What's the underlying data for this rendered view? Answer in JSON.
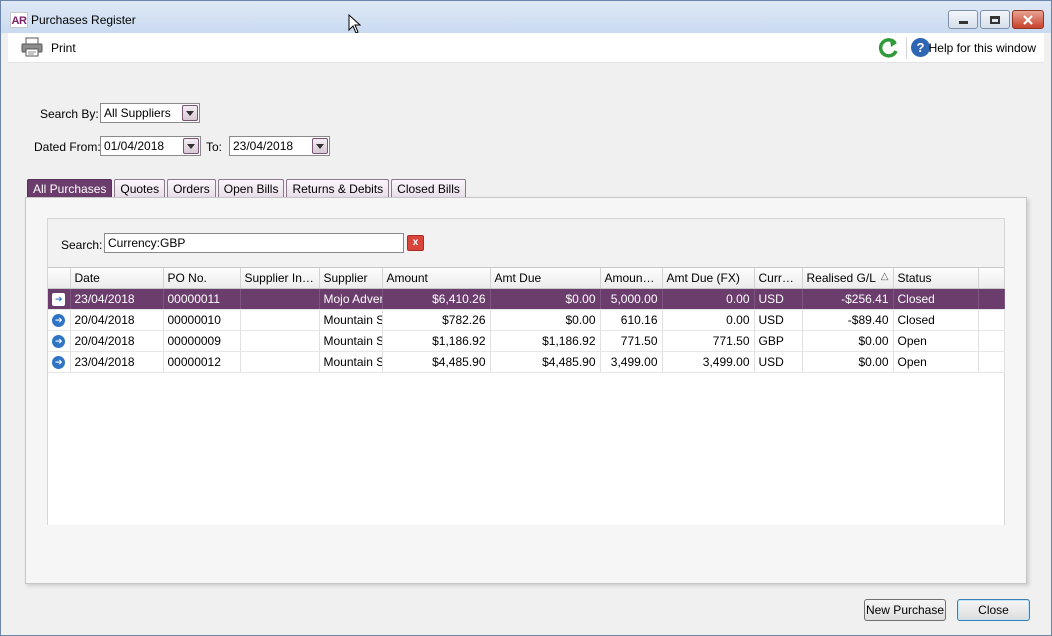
{
  "window": {
    "app_logo": "AR",
    "title": "Purchases Register"
  },
  "toolbar": {
    "print_label": "Print",
    "refresh_icon": "refresh-icon",
    "help_label": "Help for this window",
    "help_glyph": "?"
  },
  "filters": {
    "search_by_label": "Search By:",
    "search_by_value": "All Suppliers",
    "dated_from_label": "Dated From:",
    "dated_from_value": "01/04/2018",
    "to_label": "To:",
    "to_value": "23/04/2018"
  },
  "tabs": [
    {
      "label": "All Purchases",
      "active": true
    },
    {
      "label": "Quotes",
      "active": false
    },
    {
      "label": "Orders",
      "active": false
    },
    {
      "label": "Open Bills",
      "active": false
    },
    {
      "label": "Returns & Debits",
      "active": false
    },
    {
      "label": "Closed Bills",
      "active": false
    }
  ],
  "search": {
    "label": "Search:",
    "value": "Currency:GBP",
    "clear_glyph": "x"
  },
  "grid": {
    "columns": [
      "",
      "Date",
      "PO No.",
      "Supplier Inv...",
      "Supplier",
      "Amount",
      "Amt Due",
      "Amount ...",
      "Amt Due (FX)",
      "Curre...",
      "Realised G/L",
      "Status",
      ""
    ],
    "sort_indicator": "△",
    "rows": [
      {
        "date": "23/04/2018",
        "po": "00000011",
        "supplier_inv": "",
        "supplier": "Mojo Adver",
        "amount": "$6,410.26",
        "amt_due": "$0.00",
        "amount_fx": "5,000.00",
        "amt_due_fx": "0.00",
        "currency": "USD",
        "realised": "-$256.41",
        "status": "Closed",
        "selected": true
      },
      {
        "date": "20/04/2018",
        "po": "00000010",
        "supplier_inv": "",
        "supplier": "Mountain Sp",
        "amount": "$782.26",
        "amt_due": "$0.00",
        "amount_fx": "610.16",
        "amt_due_fx": "0.00",
        "currency": "USD",
        "realised": "-$89.40",
        "status": "Closed",
        "selected": false
      },
      {
        "date": "20/04/2018",
        "po": "00000009",
        "supplier_inv": "",
        "supplier": "Mountain Sp",
        "amount": "$1,186.92",
        "amt_due": "$1,186.92",
        "amount_fx": "771.50",
        "amt_due_fx": "771.50",
        "currency": "GBP",
        "realised": "$0.00",
        "status": "Open",
        "selected": false
      },
      {
        "date": "23/04/2018",
        "po": "00000012",
        "supplier_inv": "",
        "supplier": "Mountain Sp",
        "amount": "$4,485.90",
        "amt_due": "$4,485.90",
        "amount_fx": "3,499.00",
        "amt_due_fx": "3,499.00",
        "currency": "USD",
        "realised": "$0.00",
        "status": "Open",
        "selected": false
      }
    ]
  },
  "buttons": {
    "new_purchase": "New Purchase",
    "close": "Close"
  },
  "colors": {
    "accent": "#6b3d6d",
    "row_arrow": "#2f73c4"
  }
}
